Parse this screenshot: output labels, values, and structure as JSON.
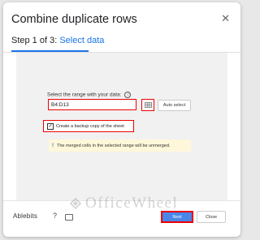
{
  "dialog": {
    "title": "Combine duplicate rows",
    "close_icon": "close-icon"
  },
  "step": {
    "prefix": "Step 1 of 3:",
    "link": "Select data"
  },
  "range": {
    "label": "Select the range with your data:",
    "value": "B4:D13",
    "grid_icon": "grid-select-icon",
    "auto_select": "Auto select"
  },
  "backup": {
    "checked": true,
    "label": "Create a backup copy of the sheet"
  },
  "notice": {
    "text": "The merged cells in the selected range will be unmerged."
  },
  "footer": {
    "brand": "Ablebits",
    "help": "?",
    "next": "Next",
    "close": "Close"
  },
  "watermark": {
    "text": "OfficeWheel"
  },
  "colors": {
    "accent": "#1a73e8",
    "primary_button": "#4a86e8",
    "highlight_border": "#e00000",
    "notice_bg": "#fef7d9"
  }
}
